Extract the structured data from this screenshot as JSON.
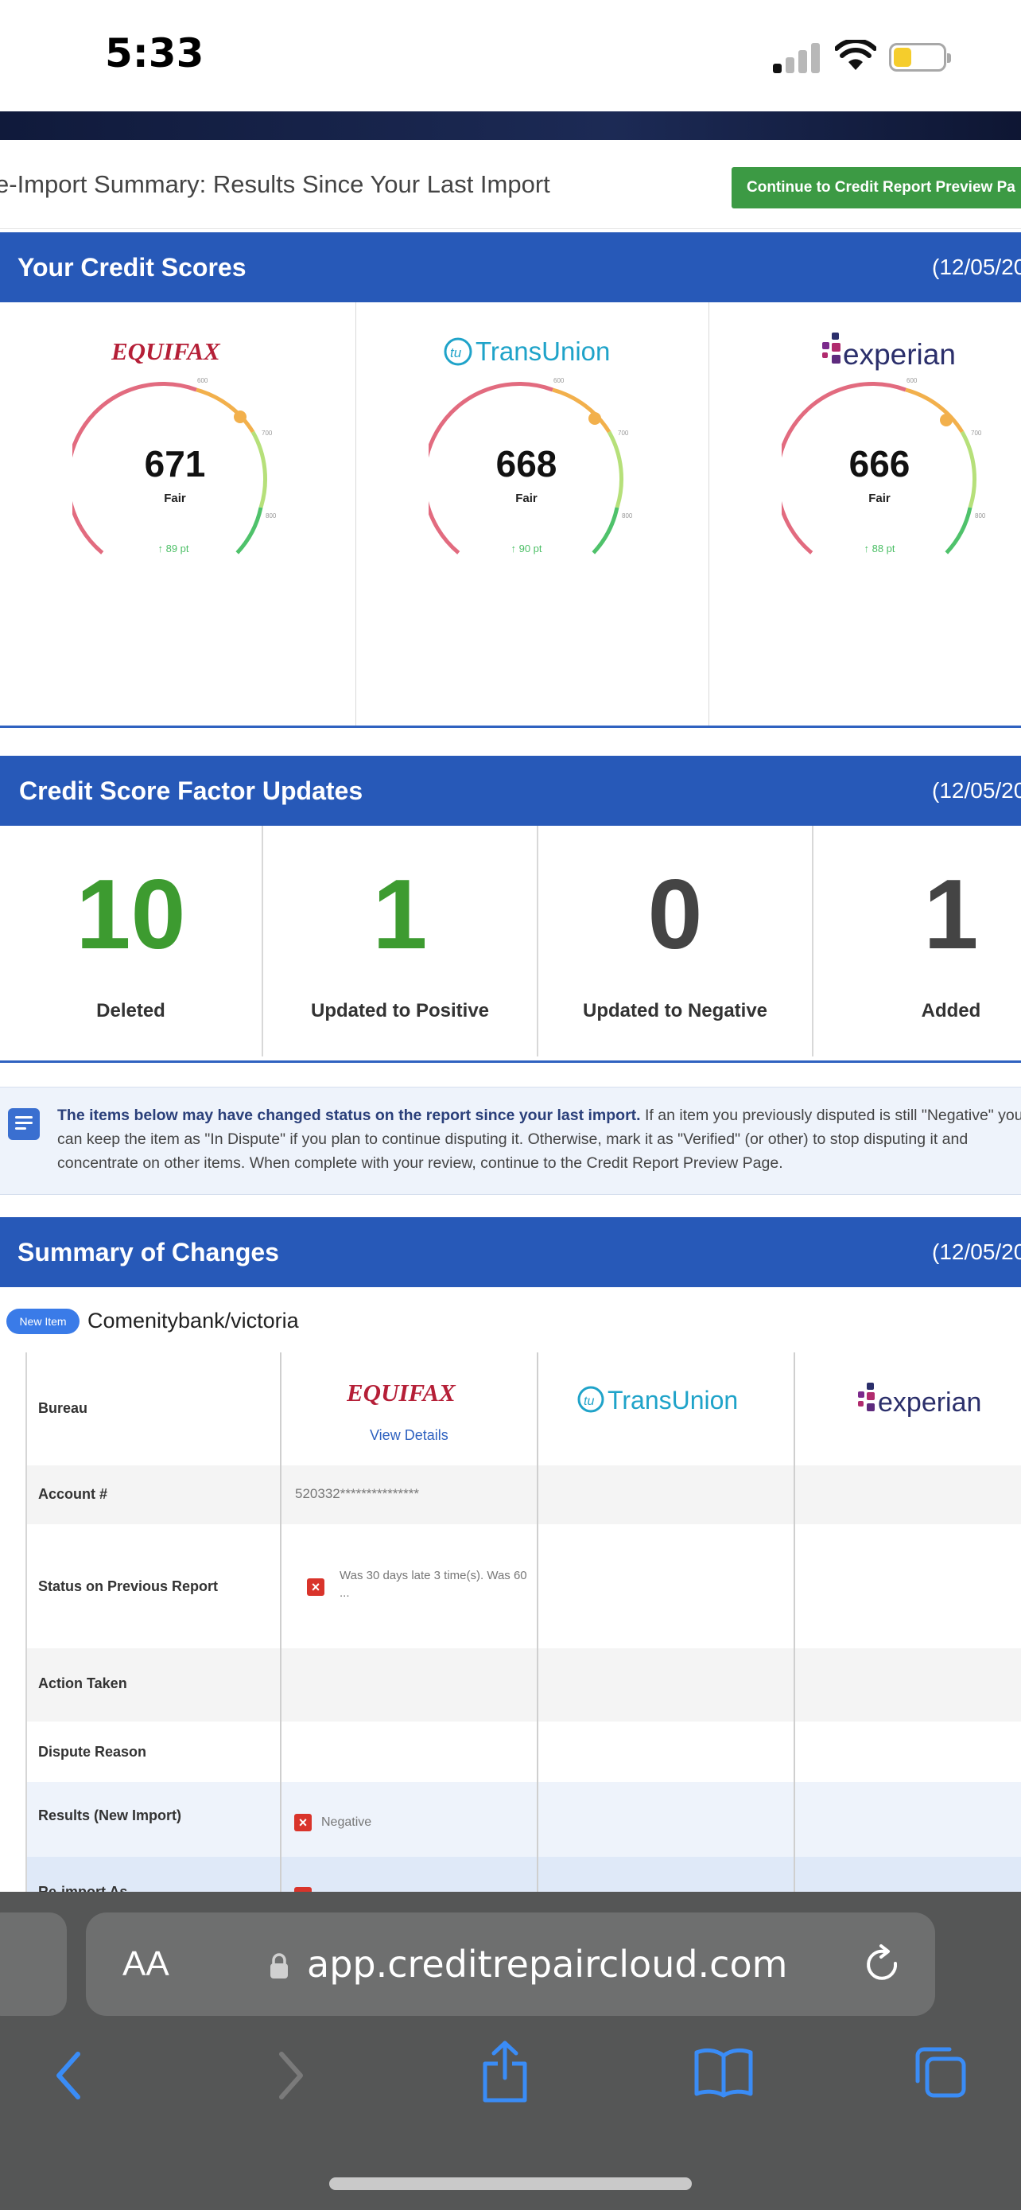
{
  "status_bar": {
    "time": "5:33"
  },
  "page": {
    "title": "e-Import Summary: Results Since Your Last Import",
    "continue_button": "Continue to Credit Report Preview Pa"
  },
  "credit_scores": {
    "title": "Your Credit Scores",
    "date": "(12/05/20",
    "gauge_ticks": [
      "600",
      "700",
      "800"
    ],
    "bureaus": [
      {
        "name": "EQUIFAX",
        "score": "671",
        "rating": "Fair",
        "change": "89 pt",
        "color": "#b51f37"
      },
      {
        "name": "TransUnion",
        "score": "668",
        "rating": "Fair",
        "change": "90 pt",
        "color": "#1fa3c9"
      },
      {
        "name": "experian",
        "score": "666",
        "rating": "Fair",
        "change": "88 pt",
        "color": "#2b2f6b"
      }
    ]
  },
  "factor_updates": {
    "title": "Credit Score Factor Updates",
    "date": "(12/05/20",
    "items": [
      {
        "value": "10",
        "label": "Deleted",
        "color": "#3d9b30"
      },
      {
        "value": "1",
        "label": "Updated to Positive",
        "color": "#3d9b30"
      },
      {
        "value": "0",
        "label": "Updated to Negative",
        "color": "#444444"
      },
      {
        "value": "1",
        "label": "Added",
        "color": "#444444"
      }
    ]
  },
  "notice": {
    "bold": "The items below may have changed status on the report since your last import.",
    "text": " If an item you previously disputed is still \"Negative\" you can keep the item as \"In Dispute\" if you plan to continue disputing it. Otherwise, mark it as \"Verified\" (or other) to stop disputing it and concentrate on other items. When complete with your review, continue to the Credit Report Preview Page."
  },
  "changes": {
    "title": "Summary of Changes",
    "date": "(12/05/20",
    "badge": "New Item",
    "item_name": "Comenitybank/victoria",
    "row_labels": [
      "Bureau",
      "Account #",
      "Status on Previous Report",
      "Action Taken",
      "Dispute Reason",
      "Results (New Import)",
      "Re-import As"
    ],
    "bureaus": [
      "EQUIFAX",
      "TransUnion",
      "experian"
    ],
    "view_details": "View Details",
    "account_number": "520332***************",
    "previous_status": "Was 30 days late 3 time(s). Was 60 ...",
    "result": "Negative"
  },
  "safari": {
    "aa": "AA",
    "url": "app.creditrepaircloud.com"
  }
}
